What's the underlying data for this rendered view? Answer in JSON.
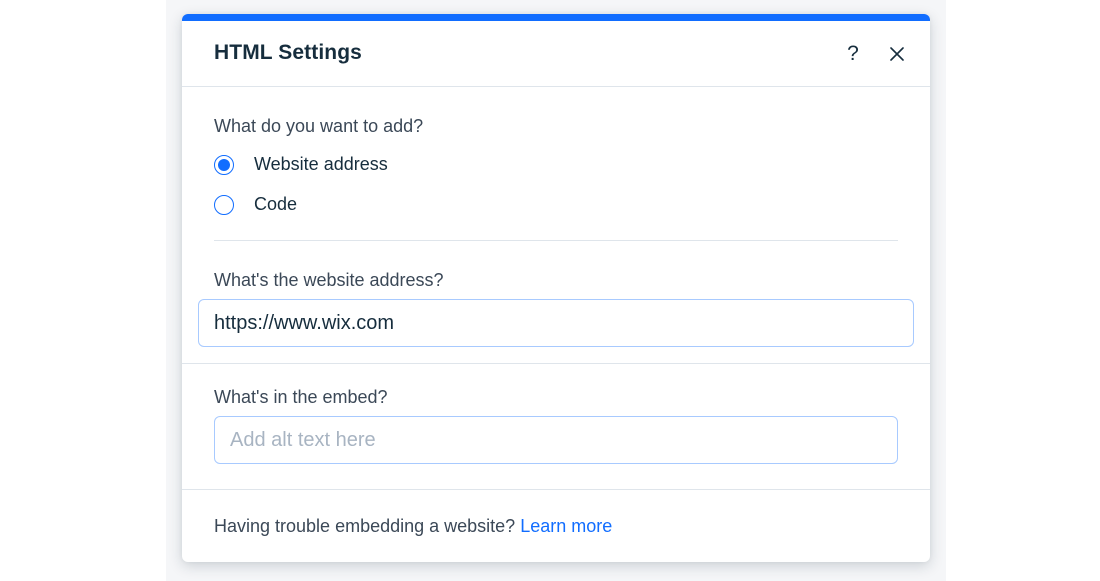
{
  "dialog": {
    "title": "HTML Settings",
    "help_icon": "question-mark-icon",
    "close_icon": "close-x-icon",
    "accent_color": "#116dff"
  },
  "add_type": {
    "question": "What do you want to add?",
    "options": [
      {
        "label": "Website address",
        "selected": true
      },
      {
        "label": "Code",
        "selected": false
      }
    ]
  },
  "website_address": {
    "label": "What's the website address?",
    "value": "https://www.wix.com"
  },
  "embed": {
    "label": "What's in the embed?",
    "placeholder": "Add alt text here",
    "value": ""
  },
  "footer": {
    "text": "Having trouble embedding a website?",
    "link": "Learn more"
  }
}
